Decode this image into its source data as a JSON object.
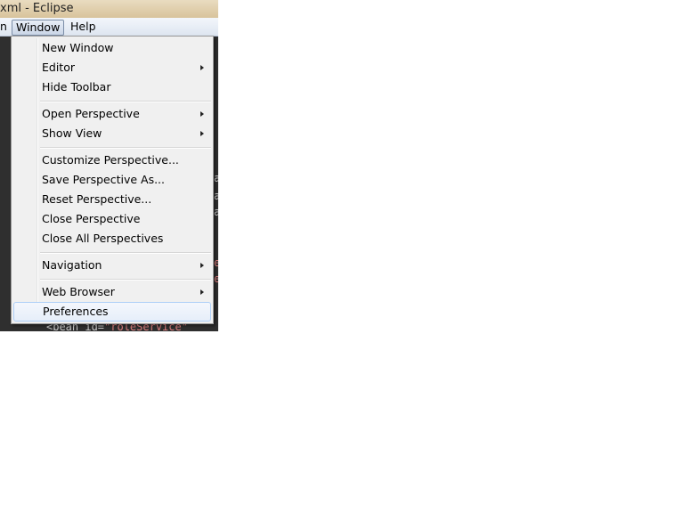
{
  "window": {
    "title": "xml - Eclipse"
  },
  "menubar": {
    "items": [
      {
        "label": "n"
      },
      {
        "label": "Window"
      },
      {
        "label": "Help"
      }
    ]
  },
  "editor": {
    "code_prefix": "<bean id=",
    "code_string": "\"roleService\"",
    "edge_chars": [
      "a",
      "a",
      "a",
      "e",
      "e"
    ]
  },
  "menu": {
    "items": [
      {
        "label": "New Window",
        "submenu": false
      },
      {
        "label": "Editor",
        "submenu": true
      },
      {
        "label": "Hide Toolbar",
        "submenu": false
      },
      {
        "label": "Open Perspective",
        "submenu": true
      },
      {
        "label": "Show View",
        "submenu": true
      },
      {
        "label": "Customize Perspective...",
        "submenu": false
      },
      {
        "label": "Save Perspective As...",
        "submenu": false
      },
      {
        "label": "Reset Perspective...",
        "submenu": false
      },
      {
        "label": "Close Perspective",
        "submenu": false
      },
      {
        "label": "Close All Perspectives",
        "submenu": false
      },
      {
        "label": "Navigation",
        "submenu": true
      },
      {
        "label": "Web Browser",
        "submenu": true
      },
      {
        "label": "Preferences",
        "submenu": false,
        "highlighted": true
      }
    ]
  }
}
